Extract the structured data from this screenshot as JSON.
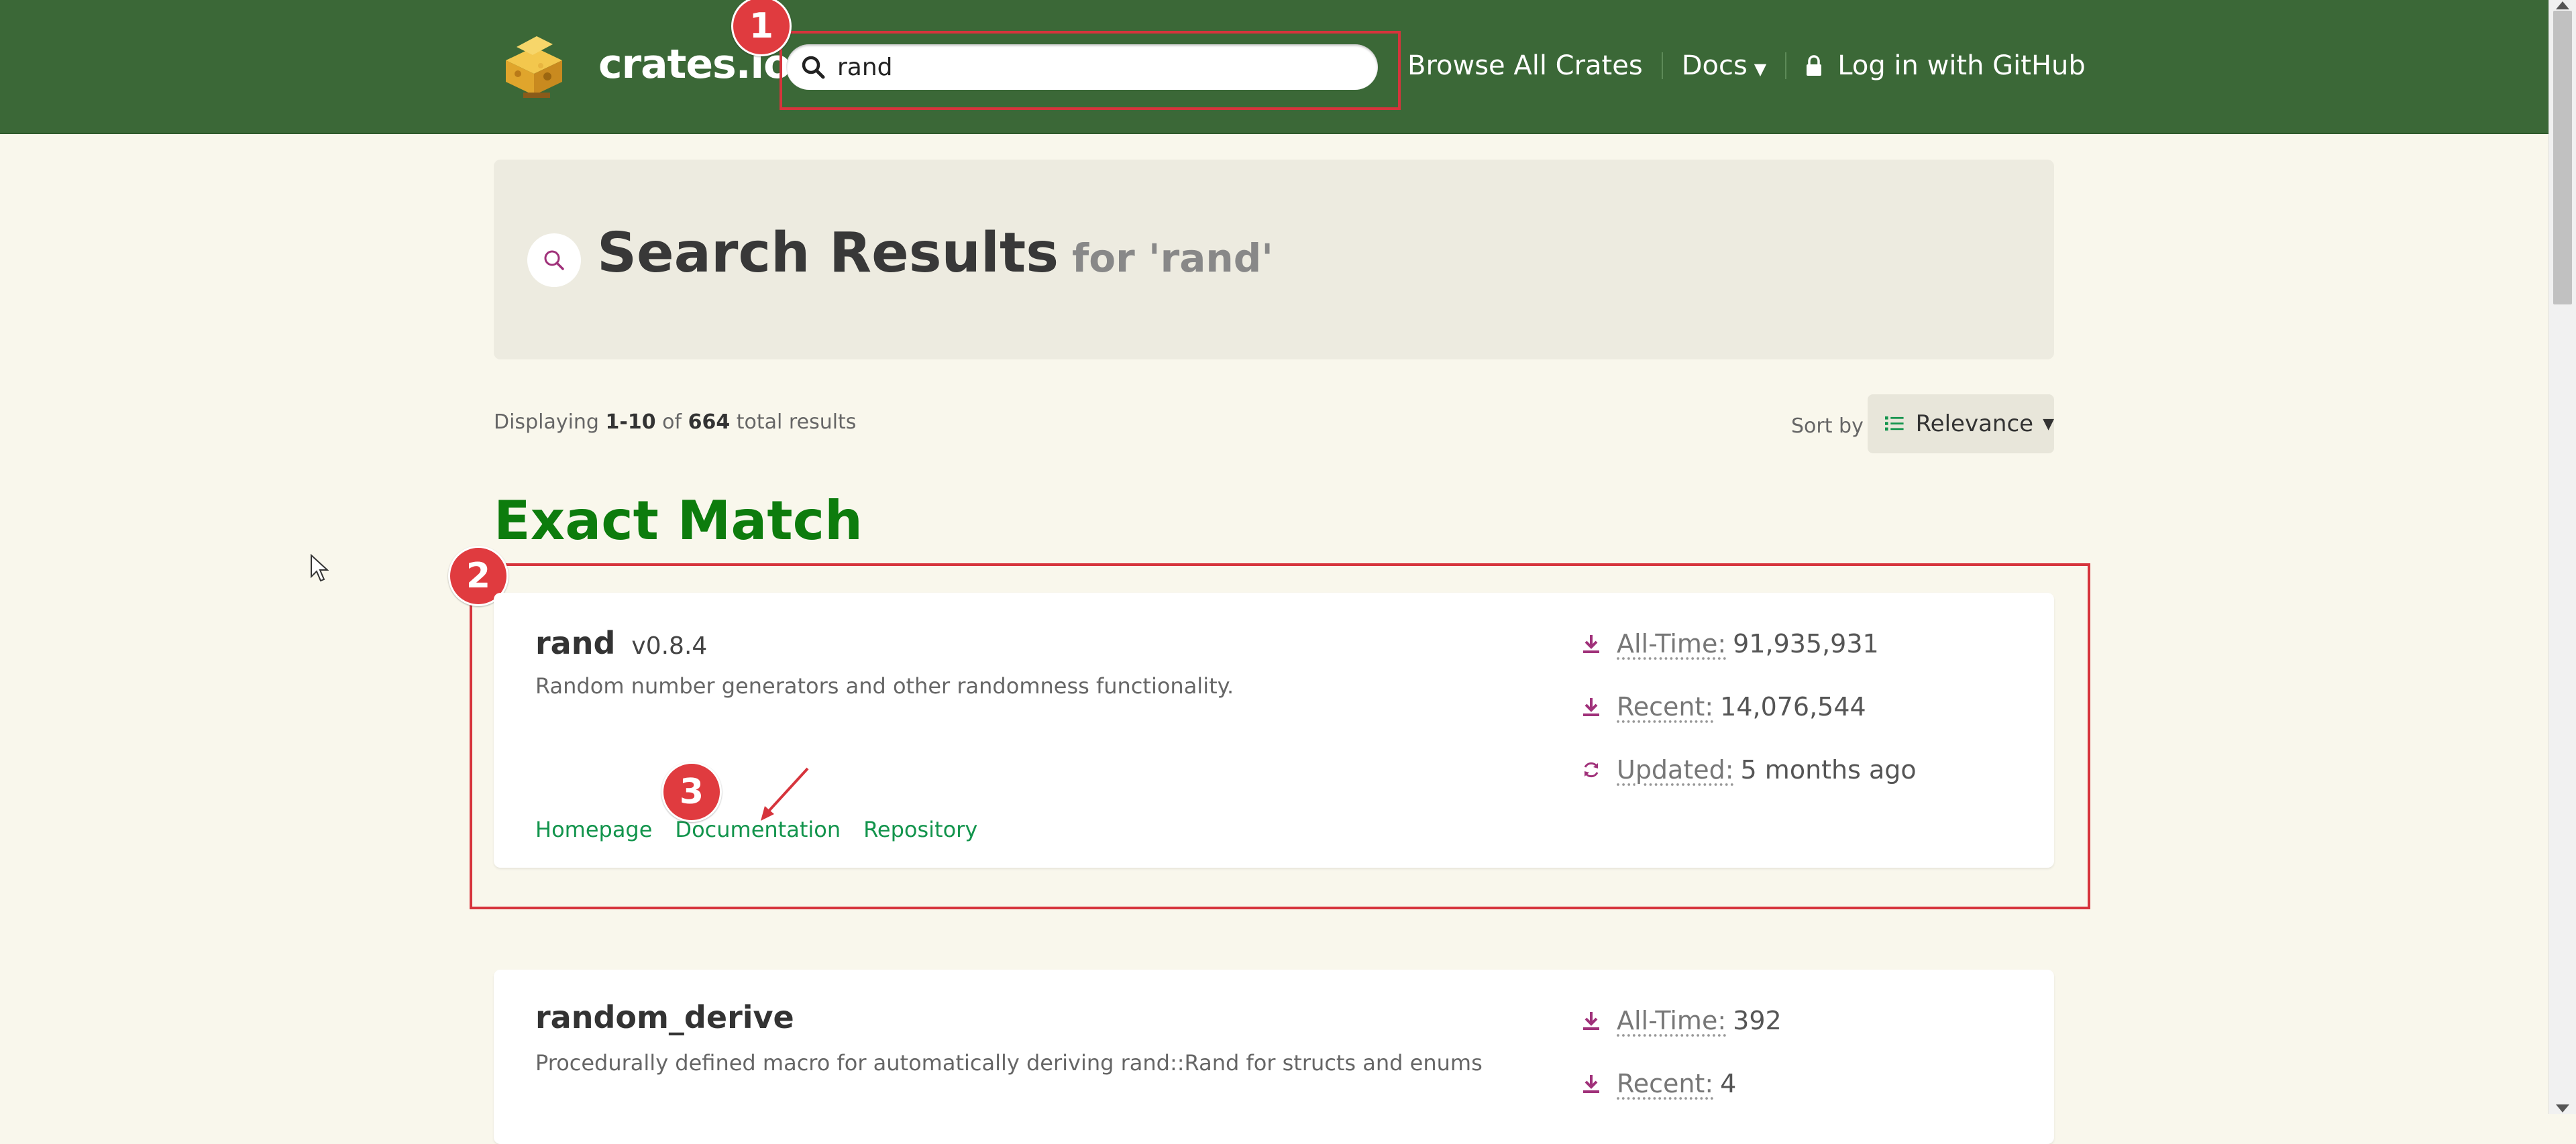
{
  "header": {
    "logo_text": "crates.io",
    "search": {
      "value": "rand",
      "placeholder": ""
    },
    "nav": {
      "browse": "Browse All Crates",
      "docs": "Docs",
      "login": "Log in with GitHub"
    }
  },
  "banner": {
    "title": "Search Results",
    "subtitle": "for 'rand'"
  },
  "results_info": {
    "prefix": "Displaying",
    "range": "1-10",
    "of": "of",
    "total": "664",
    "suffix": "total results"
  },
  "sort": {
    "label": "Sort by",
    "value": "Relevance"
  },
  "exact_match_heading": "Exact Match",
  "annotations": {
    "badge1": "1",
    "badge2": "2",
    "badge3": "3"
  },
  "crates": [
    {
      "name": "rand",
      "version": "v0.8.4",
      "description": "Random number generators and other randomness functionality.",
      "links": {
        "homepage": "Homepage",
        "documentation": "Documentation",
        "repository": "Repository"
      },
      "all_time_label": "All-Time:",
      "all_time": "91,935,931",
      "recent_label": "Recent:",
      "recent": "14,076,544",
      "updated_label": "Updated:",
      "updated": "5 months ago"
    },
    {
      "name": "random_derive",
      "version": "",
      "description": "Procedurally defined macro for automatically deriving rand::Rand for structs and enums",
      "all_time_label": "All-Time:",
      "all_time": "392",
      "recent_label": "Recent:",
      "recent": "4"
    }
  ],
  "colors": {
    "header_bg": "#3b6837",
    "page_bg": "#f9f7ec",
    "link_green": "#12944c",
    "exact_green": "#0d7c0d",
    "stat_icon": "#a0317a",
    "annotation_red": "#d6343c"
  }
}
